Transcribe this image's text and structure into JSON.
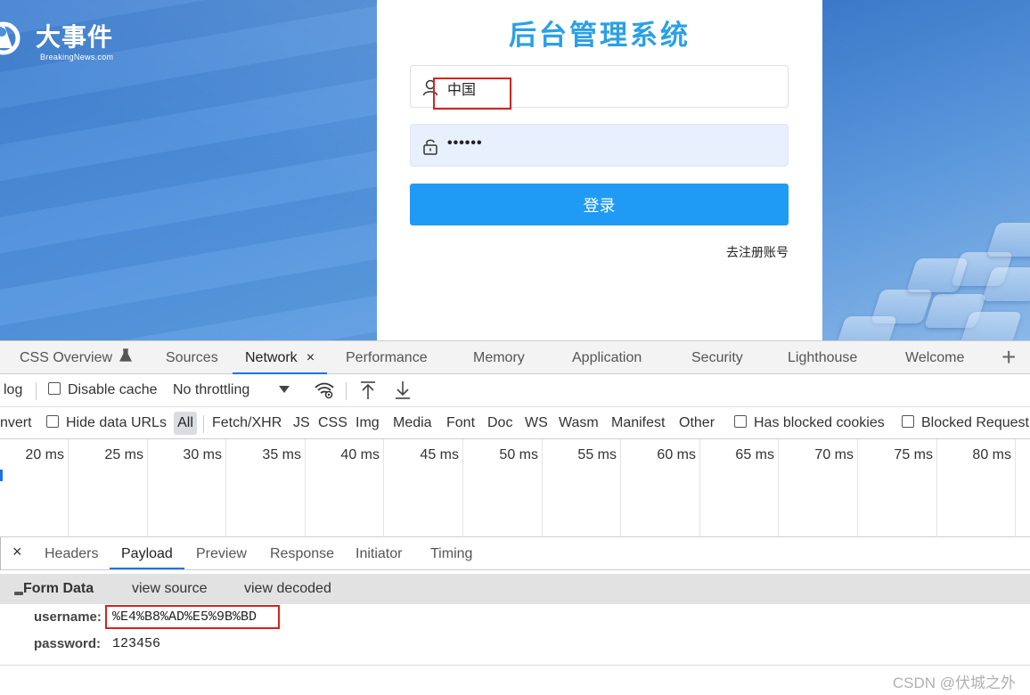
{
  "app": {
    "logo_name": "大事件",
    "logo_sub": "BreakingNews.com",
    "title": "后台管理系统",
    "username_value": "中国",
    "password_value": "••••••",
    "login_button": "登录",
    "register_link": "去注册账号",
    "button_color": "#1f9bf5",
    "title_color": "#2aa0e6"
  },
  "devtools": {
    "panel_tabs": [
      {
        "label": "CSS Overview",
        "icon": "flask-icon"
      },
      {
        "label": "Sources"
      },
      {
        "label": "Network",
        "active": true
      },
      {
        "label": "Performance"
      },
      {
        "label": "Memory"
      },
      {
        "label": "Application"
      },
      {
        "label": "Security"
      },
      {
        "label": "Lighthouse"
      },
      {
        "label": "Welcome"
      }
    ],
    "close_glyph": "×",
    "toolbar1": {
      "preserve_log_fragment": "log",
      "disable_cache": "Disable cache",
      "throttling": "No throttling"
    },
    "toolbar2": {
      "invert_fragment": "nvert",
      "hide_data_urls": "Hide data URLs",
      "filters": [
        "All",
        "Fetch/XHR",
        "JS",
        "CSS",
        "Img",
        "Media",
        "Font",
        "Doc",
        "WS",
        "Wasm",
        "Manifest",
        "Other"
      ],
      "has_blocked_cookies": "Has blocked cookies",
      "blocked_requests": "Blocked Request"
    },
    "timeline_ticks": [
      "20 ms",
      "25 ms",
      "30 ms",
      "35 ms",
      "40 ms",
      "45 ms",
      "50 ms",
      "55 ms",
      "60 ms",
      "65 ms",
      "70 ms",
      "75 ms",
      "80 ms"
    ],
    "detail_tabs": [
      "Headers",
      "Payload",
      "Preview",
      "Response",
      "Initiator",
      "Timing"
    ],
    "active_detail_tab": "Payload",
    "form_data": {
      "title": "Form Data",
      "view_source": "view source",
      "view_decoded": "view decoded",
      "rows": [
        {
          "key": "username:",
          "value": "%E4%B8%AD%E5%9B%BD"
        },
        {
          "key": "password:",
          "value": "123456"
        }
      ]
    },
    "accent_color": "#1a73e8"
  },
  "watermark": "CSDN @伏城之外"
}
